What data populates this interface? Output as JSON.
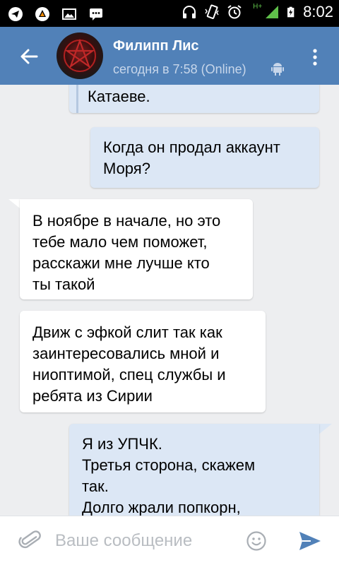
{
  "status_bar": {
    "time": "8:02",
    "network": "H+",
    "icons": [
      "telegram-icon",
      "vlc-icon",
      "image-icon",
      "messages-icon",
      "headphones-icon",
      "vibrate-icon",
      "alarm-icon",
      "signal-icon",
      "battery-charging-icon"
    ]
  },
  "header": {
    "contact_name": "Филипп Лис",
    "last_seen": "сегодня в 7:58 (Online)",
    "accent_color": "#5181b8"
  },
  "messages": [
    {
      "direction": "out",
      "lines": [
        "Катаеве."
      ],
      "quoted": true
    },
    {
      "direction": "out",
      "lines": [
        "Когда он продал аккаунт",
        "Моря?"
      ]
    },
    {
      "direction": "in",
      "lines": [
        "В ноябре в начале, но это",
        "тебе мало чем поможет,",
        "расскажи мне лучше кто",
        "ты такой"
      ]
    },
    {
      "direction": "in",
      "lines": [
        "Движ с эфкой слит так как",
        "заинтересовались мной и",
        "ниоптимой, спец службы и",
        "ребята из Сирии"
      ]
    },
    {
      "direction": "out",
      "lines": [
        "Я из УПЧК.",
        "Третья сторона, скажем",
        "так.",
        "Долго жрали попкорн,"
      ]
    }
  ],
  "composer": {
    "placeholder": "Ваше сообщение"
  }
}
